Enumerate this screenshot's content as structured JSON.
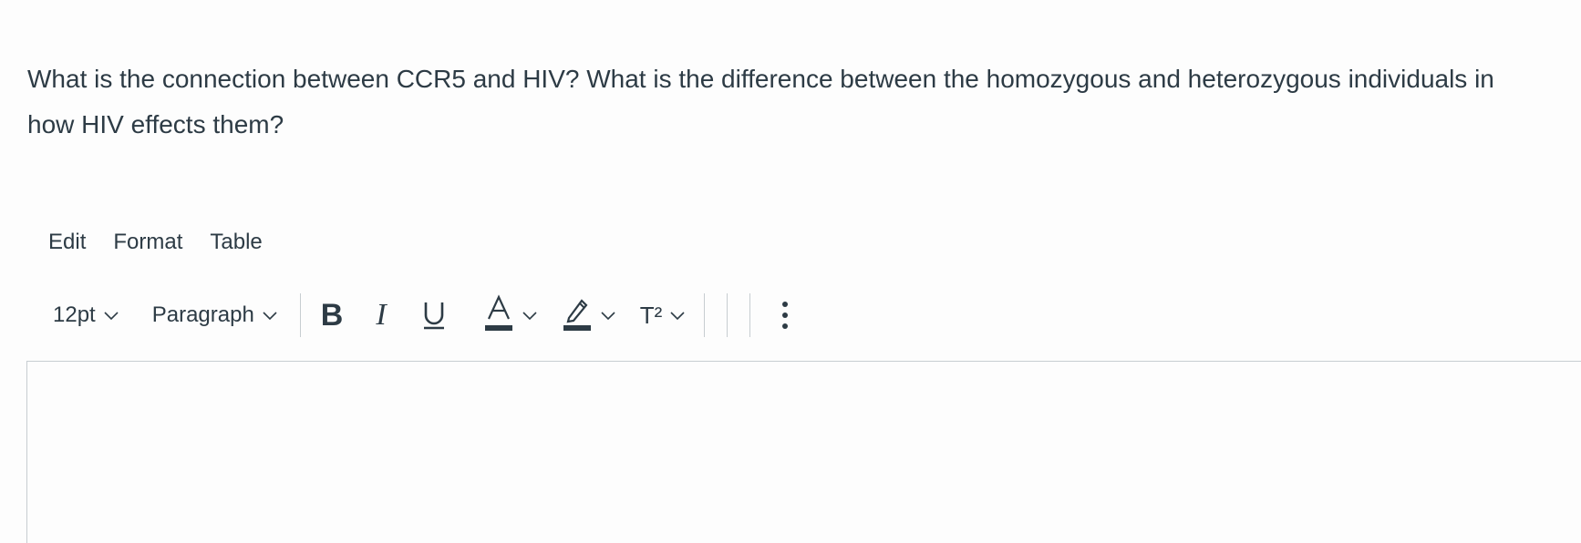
{
  "question": {
    "text": "What is the connection between CCR5 and HIV? What is the difference between the homozygous and heterozygous individuals in how HIV effects them?"
  },
  "menubar": {
    "items": [
      "Edit",
      "Format",
      "Table"
    ]
  },
  "toolbar": {
    "font_size": "12pt",
    "block_format": "Paragraph",
    "bold_label": "B",
    "italic_label": "I",
    "superscript_label": "T²",
    "icons": [
      "chevron-down-icon",
      "underline-icon",
      "text-color-icon",
      "highlight-color-icon",
      "superscript-icon",
      "more-vertical-icon"
    ]
  },
  "editor": {
    "content": ""
  },
  "colors": {
    "text": "#2d3b45",
    "border": "#c7cdd1",
    "background": "#fdfdfd"
  }
}
